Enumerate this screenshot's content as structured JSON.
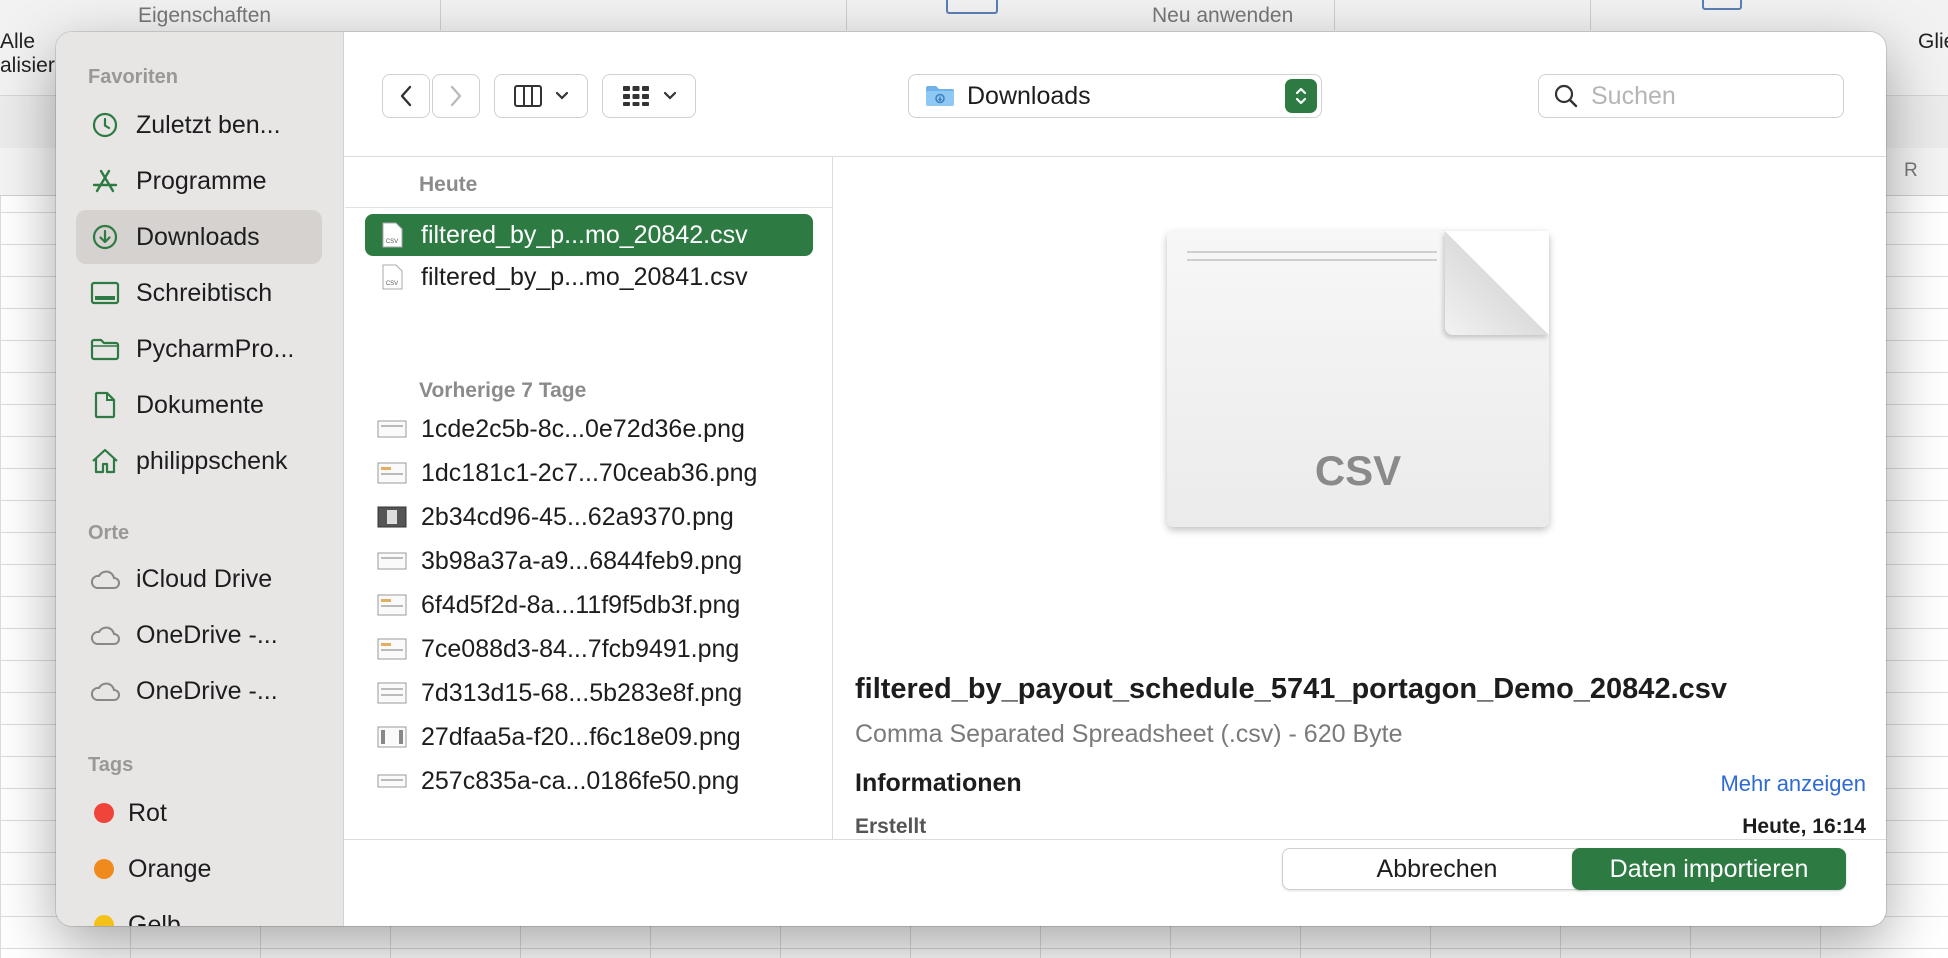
{
  "background_app": {
    "items": [
      "Alle",
      "alisier",
      "Eigenschaften",
      "Neu anwenden",
      "Glie",
      "R"
    ]
  },
  "sidebar": {
    "sections": [
      {
        "title": "Favoriten",
        "items": [
          {
            "label": "Zuletzt ben...",
            "icon": "clock-icon"
          },
          {
            "label": "Programme",
            "icon": "applications-icon"
          },
          {
            "label": "Downloads",
            "icon": "download-icon",
            "selected": true
          },
          {
            "label": "Schreibtisch",
            "icon": "desktop-icon"
          },
          {
            "label": "PycharmPro...",
            "icon": "folder-icon"
          },
          {
            "label": "Dokumente",
            "icon": "document-icon"
          },
          {
            "label": "philippschenk",
            "icon": "home-icon"
          }
        ]
      },
      {
        "title": "Orte",
        "items": [
          {
            "label": "iCloud Drive",
            "icon": "cloud-icon"
          },
          {
            "label": "OneDrive -...",
            "icon": "cloud-icon"
          },
          {
            "label": "OneDrive -...",
            "icon": "cloud-icon"
          }
        ]
      },
      {
        "title": "Tags",
        "items": [
          {
            "label": "Rot",
            "color": "#f0443a"
          },
          {
            "label": "Orange",
            "color": "#f08a1c"
          },
          {
            "label": "Gelb",
            "color": "#f3c118"
          }
        ]
      }
    ]
  },
  "toolbar": {
    "location": "Downloads",
    "search_placeholder": "Suchen"
  },
  "files": {
    "groups": [
      {
        "title": "Heute",
        "items": [
          {
            "name": "filtered_by_p...mo_20842.csv",
            "selected": true
          },
          {
            "name": "filtered_by_p...mo_20841.csv"
          }
        ]
      },
      {
        "title": "Vorherige 7 Tage",
        "items": [
          {
            "name": "1cde2c5b-8c...0e72d36e.png"
          },
          {
            "name": "1dc181c1-2c7...70ceab36.png"
          },
          {
            "name": "2b34cd96-45...62a9370.png"
          },
          {
            "name": "3b98a37a-a9...6844feb9.png"
          },
          {
            "name": "6f4d5f2d-8a...11f9f5db3f.png"
          },
          {
            "name": "7ce088d3-84...7fcb9491.png"
          },
          {
            "name": "7d313d15-68...5b283e8f.png"
          },
          {
            "name": "27dfaa5a-f20...f6c18e09.png"
          },
          {
            "name": "257c835a-ca...0186fe50.png"
          }
        ]
      }
    ]
  },
  "preview": {
    "doc_type": "CSV",
    "file_name": "filtered_by_payout_schedule_5741_portagon_Demo_20842.csv",
    "kind": "Comma Separated Spreadsheet (.csv) - 620 Byte",
    "info_title": "Informationen",
    "more_link": "Mehr anzeigen",
    "created_label": "Erstellt",
    "created_value": "Heute, 16:14"
  },
  "buttons": {
    "cancel": "Abbrechen",
    "import": "Daten importieren"
  },
  "colors": {
    "accent": "#2d7a43",
    "link": "#2f6bd1"
  }
}
